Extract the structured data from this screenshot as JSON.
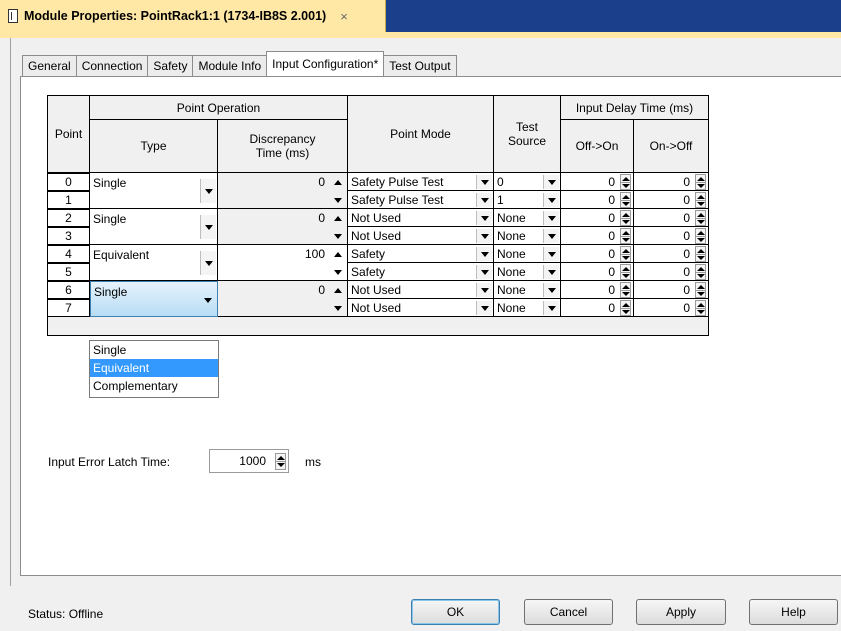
{
  "window": {
    "title": "Module Properties: PointRack1:1 (1734-IB8S 2.001)",
    "close_glyph": "×"
  },
  "tabs": [
    {
      "label": "General"
    },
    {
      "label": "Connection"
    },
    {
      "label": "Safety"
    },
    {
      "label": "Module Info"
    },
    {
      "label": "Input Configuration*",
      "active": true
    },
    {
      "label": "Test Output"
    }
  ],
  "grid": {
    "headers": {
      "point": "Point",
      "point_operation": "Point Operation",
      "type": "Type",
      "discrepancy": "Discrepancy Time (ms)",
      "point_mode": "Point Mode",
      "test_source": "Test Source",
      "input_delay": "Input Delay Time (ms)",
      "off_on": "Off->On",
      "on_off": "On->Off"
    },
    "pairs": [
      {
        "type": "Single",
        "discrepancy": "0"
      },
      {
        "type": "Single",
        "discrepancy": "0"
      },
      {
        "type": "Equivalent",
        "discrepancy": "100"
      },
      {
        "type": "Single",
        "discrepancy": "0",
        "selected": true
      }
    ],
    "rows": [
      {
        "point": "0",
        "mode": "Safety Pulse Test",
        "source": "0",
        "off_on": "0",
        "on_off": "0"
      },
      {
        "point": "1",
        "mode": "Safety Pulse Test",
        "source": "1",
        "off_on": "0",
        "on_off": "0"
      },
      {
        "point": "2",
        "mode": "Not Used",
        "source": "None",
        "off_on": "0",
        "on_off": "0"
      },
      {
        "point": "3",
        "mode": "Not Used",
        "source": "None",
        "off_on": "0",
        "on_off": "0"
      },
      {
        "point": "4",
        "mode": "Safety",
        "source": "None",
        "off_on": "0",
        "on_off": "0"
      },
      {
        "point": "5",
        "mode": "Safety",
        "source": "None",
        "off_on": "0",
        "on_off": "0"
      },
      {
        "point": "6",
        "mode": "Not Used",
        "source": "None",
        "off_on": "0",
        "on_off": "0"
      },
      {
        "point": "7",
        "mode": "Not Used",
        "source": "None",
        "off_on": "0",
        "on_off": "0"
      }
    ]
  },
  "type_dropdown": {
    "options": [
      "Single",
      "Equivalent",
      "Complementary"
    ],
    "highlighted": "Equivalent"
  },
  "latch": {
    "label": "Input Error Latch Time:",
    "value": "1000",
    "unit": "ms"
  },
  "status": {
    "text": "Status:  Offline"
  },
  "buttons": {
    "ok": "OK",
    "cancel": "Cancel",
    "apply": "Apply",
    "help": "Help"
  },
  "colors": {
    "title_bar": "#1b3f8b",
    "active_doc_tab": "#ffe8a6",
    "selection": "#3399ff"
  }
}
